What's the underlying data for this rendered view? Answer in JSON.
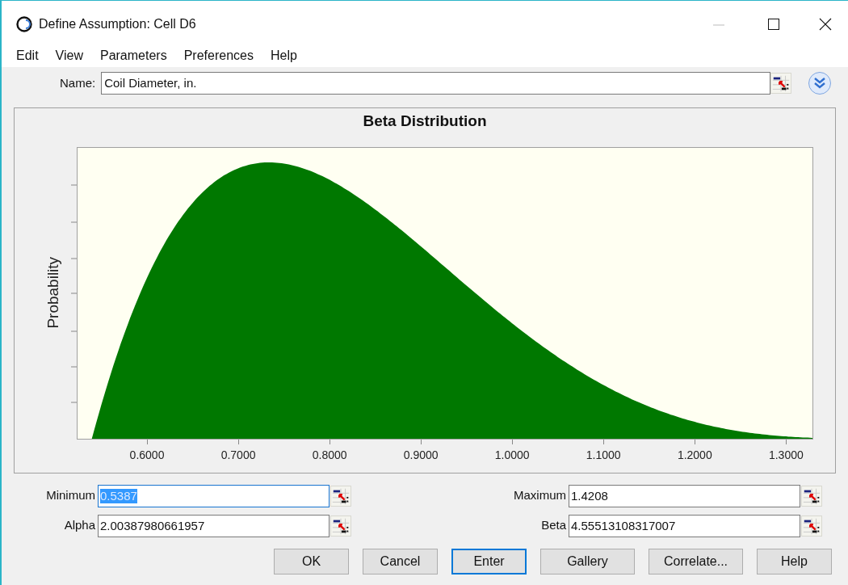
{
  "window": {
    "title": "Define Assumption: Cell D6"
  },
  "menu": [
    {
      "label": "Edit"
    },
    {
      "label": "View"
    },
    {
      "label": "Parameters"
    },
    {
      "label": "Preferences"
    },
    {
      "label": "Help"
    }
  ],
  "name_field": {
    "label": "Name:",
    "value": "Coil Diameter, in."
  },
  "chart": {
    "title": "Beta Distribution",
    "ylabel": "Probability",
    "xtick_labels": [
      "0.6000",
      "0.7000",
      "0.8000",
      "0.9000",
      "1.0000",
      "1.1000",
      "1.2000",
      "1.3000"
    ]
  },
  "parameters": [
    {
      "label": "Minimum",
      "value": "0.5387",
      "selected": true
    },
    {
      "label": "Maximum",
      "value": "1.4208",
      "selected": false
    },
    {
      "label": "Alpha",
      "value": "2.00387980661957",
      "selected": false
    },
    {
      "label": "Beta",
      "value": "4.55513108317007",
      "selected": false
    }
  ],
  "buttons": [
    {
      "label": "OK",
      "focused": false
    },
    {
      "label": "Cancel",
      "focused": false
    },
    {
      "label": "Enter",
      "focused": true
    },
    {
      "label": "Gallery",
      "focused": false
    },
    {
      "label": "Correlate...",
      "focused": false
    },
    {
      "label": "Help",
      "focused": false
    }
  ]
}
